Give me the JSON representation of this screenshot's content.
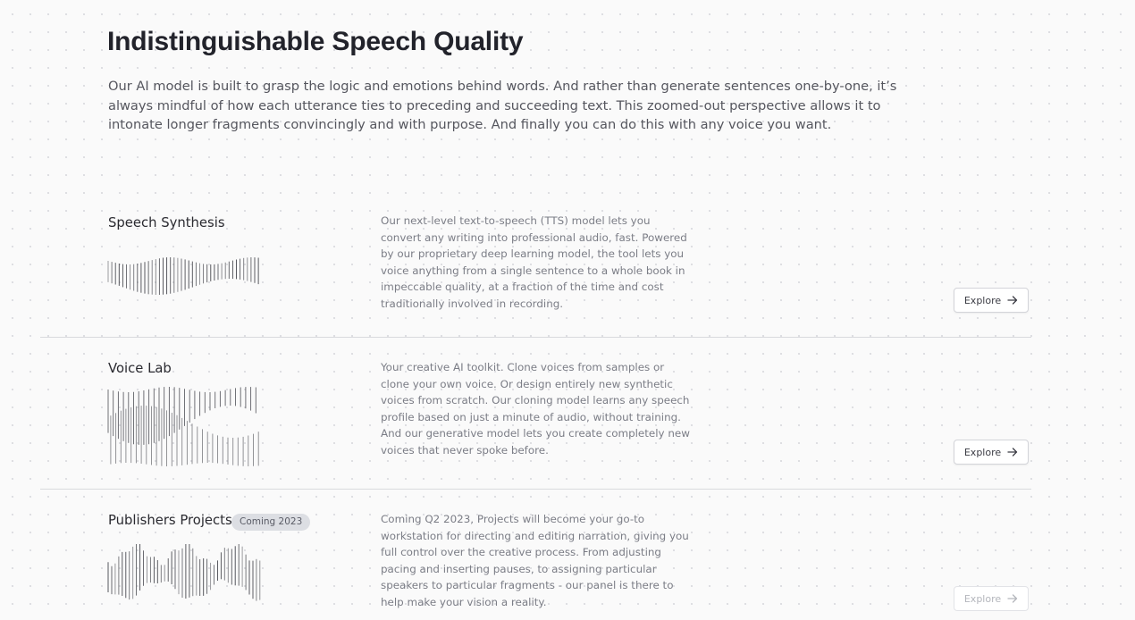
{
  "page": {
    "title": "Indistinguishable Speech Quality",
    "intro": "Our AI model is built to grasp the logic and emotions behind words. And rather than generate sentences one-by-one, it’s always mindful of how each utterance ties to preceding and succeeding text. This zoomed-out perspective allows it to intonate longer fragments convincingly and with purpose. And finally you can do this with any voice you want."
  },
  "sections": [
    {
      "title": "Speech Synthesis",
      "description": "Our next-level text-to-speech (TTS) model lets you convert any writing into professional audio, fast. Powered by our proprietary deep learning model, the tool lets you voice anything from a single sentence to a whole book in impeccable quality, at a fraction of the time and cost traditionally involved in recording.",
      "button_label": "Explore",
      "button_icon": "arrow-right-icon",
      "waveform_icon": "waveform-icon"
    },
    {
      "title": "Voice Lab",
      "description": "Your creative AI toolkit. Clone voices from samples or clone your own voice. Or design entirely new synthetic voices from scratch. Our cloning model learns any speech profile based on just a minute of audio, without training. And our generative model lets you create completely new voices that never spoke before.",
      "button_label": "Explore",
      "button_icon": "arrow-right-icon",
      "waveform_icon": "waveform-icon"
    },
    {
      "title": "Publishers Projects",
      "badge": "Coming 2023",
      "description": "Coming Q2 2023, Projects will become your go-to workstation for directing and editing narration, giving you full control over the creative process. From adjusting pacing and inserting pauses, to assigning particular speakers to particular fragments - our panel is there to help make your vision a reality.",
      "button_label": "Explore",
      "button_icon": "arrow-right-icon",
      "button_state": "disabled",
      "waveform_icon": "waveform-icon"
    }
  ],
  "colors": {
    "background": "#fafafa",
    "title": "#22232b",
    "body_text": "#55565e",
    "description_text": "#7b7d86",
    "badge_bg": "#dcdee3",
    "divider": "#d9dadd",
    "waveform": "#3c3d44"
  }
}
